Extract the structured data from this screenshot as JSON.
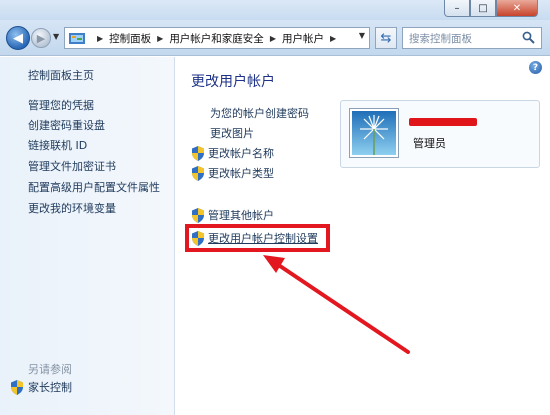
{
  "window": {
    "minimize": "–",
    "maximize": "□",
    "close": "✕"
  },
  "nav": {
    "breadcrumb": [
      "控制面板",
      "用户帐户和家庭安全",
      "用户帐户"
    ],
    "search_placeholder": "搜索控制面板"
  },
  "left": {
    "home": "控制面板主页",
    "items": [
      "管理您的凭据",
      "创建密码重设盘",
      "链接联机 ID",
      "管理文件加密证书",
      "配置高级用户配置文件属性",
      "更改我的环境变量"
    ],
    "see_also": "另请参阅",
    "parental": "家长控制"
  },
  "main": {
    "title": "更改用户帐户",
    "tasks": {
      "create_password": "为您的帐户创建密码",
      "change_picture": "更改图片",
      "change_name": "更改帐户名称",
      "change_type": "更改帐户类型",
      "manage_other": "管理其他帐户",
      "uac_settings": "更改用户帐户控制设置"
    },
    "account": {
      "role": "管理员"
    }
  },
  "colors": {
    "annotation_red": "#e3171f",
    "title_blue": "#1e3287"
  }
}
